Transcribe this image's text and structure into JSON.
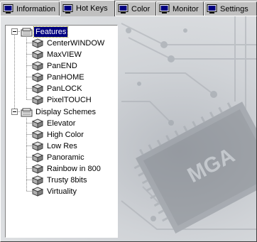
{
  "tabs": [
    {
      "label": "Information",
      "icon": "monitor-icon",
      "active": false
    },
    {
      "label": "Hot Keys",
      "icon": "monitor-icon",
      "active": true
    },
    {
      "label": "Color",
      "icon": "monitor-icon",
      "active": false
    },
    {
      "label": "Monitor",
      "icon": "monitor-icon",
      "active": false
    },
    {
      "label": "Settings",
      "icon": "monitor-icon",
      "active": false
    }
  ],
  "tree": {
    "groups": [
      {
        "label": "Features",
        "selected": true,
        "expanded": true,
        "items": [
          "CenterWINDOW",
          "MaxVIEW",
          "PanEND",
          "PanHOME",
          "PanLOCK",
          "PixelTOUCH"
        ]
      },
      {
        "label": "Display Schemes",
        "selected": false,
        "expanded": true,
        "items": [
          "Elevator",
          "High Color",
          "Low Res",
          "Panoramic",
          "Rainbow in 800",
          "Trusty 8bits",
          "Virtuality"
        ]
      }
    ]
  },
  "background": {
    "chip_text": "MGA"
  },
  "colors": {
    "selection": "#000080",
    "face": "#c0c0c0"
  }
}
